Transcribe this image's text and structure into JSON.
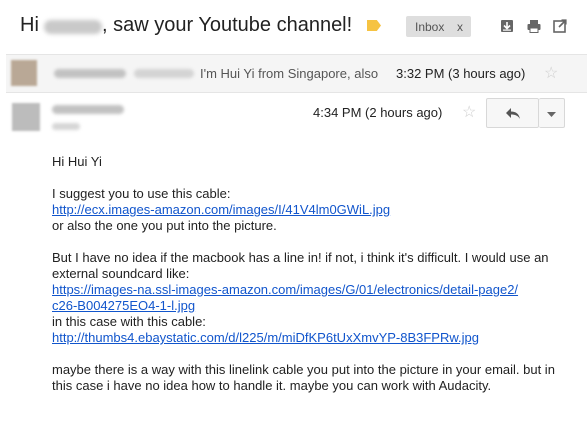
{
  "thread": {
    "subject_prefix": "Hi",
    "subject_suffix": ", saw your Youtube channel!",
    "label": "Inbox",
    "label_close": "x"
  },
  "icons": {
    "download": "download-icon",
    "print": "print-icon",
    "newwindow": "new-window-icon",
    "reply": "reply-icon",
    "more": "chevron-down-icon",
    "star": "star-icon",
    "label": "label-tag-icon"
  },
  "messages": {
    "first": {
      "snippet": "I'm Hui Yi from Singapore, also",
      "time": "3:32 PM (3 hours ago)"
    },
    "second": {
      "time": "4:34 PM (2 hours ago)",
      "greeting": "Hi Hui Yi",
      "p1_text": "I suggest you to use this cable:",
      "p1_link": "http://ecx.images-amazon.com/images/I/41V4lm0GWiL.jpg",
      "p1_after": "or also the one you put into the picture.",
      "p2_text": "But I have no idea if the macbook has a line in! if not, i think it's difficult. I would use an external soundcard like:",
      "p2_link1": "https://images-na.ssl-images-amazon.com/images/G/01/electronics/detail-page2/c26-B004275EO4-1-l.jpg",
      "p2_mid": "in this case with this cable:",
      "p2_link2": "http://thumbs4.ebaystatic.com/d/l225/m/miDfKP6tUxXmvYP-8B3FPRw.jpg",
      "p3_text": "maybe there is a way with this linelink cable you put into the picture in your email. but in this case i have no idea how to handle it. maybe you can work with Audacity."
    }
  },
  "colors": {
    "link": "#1155cc",
    "label_tag": "#f6c342",
    "collapsed_bg": "#f5f5f5"
  }
}
